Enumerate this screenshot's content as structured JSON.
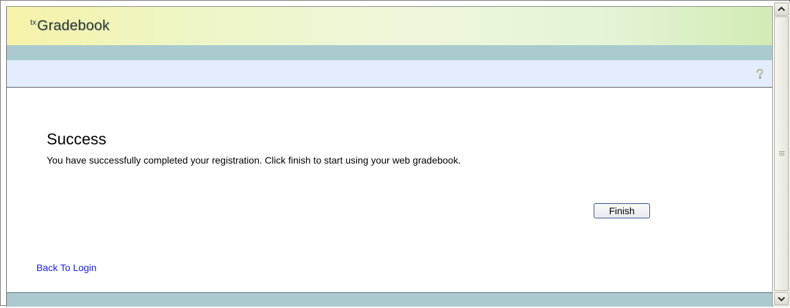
{
  "header": {
    "logo_prefix": "tx",
    "logo_text": "Gradebook"
  },
  "success": {
    "title": "Success",
    "message": "You have successfully completed your registration. Click finish to start using your web gradebook."
  },
  "actions": {
    "finish_label": "Finish",
    "back_link": "Back To Login"
  },
  "icons": {
    "help": "help-question-icon",
    "scroll_up": "chevron-up-icon",
    "scroll_down": "chevron-down-icon",
    "scroll_grip": "grip-lines-icon"
  },
  "colors": {
    "header_gradient_start": "#f6f2a8",
    "header_gradient_end": "#d2ecb4",
    "teal_bar": "#a9cbd0",
    "toolbar": "#e3edfc",
    "link": "#1a1aff",
    "button_border": "#2d4a8a"
  }
}
